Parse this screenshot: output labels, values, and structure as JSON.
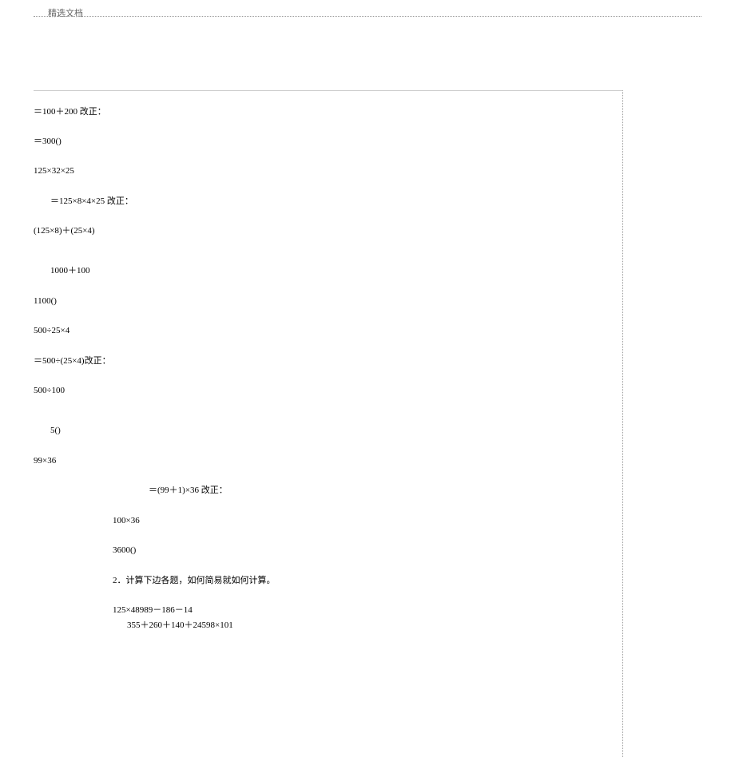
{
  "header": {
    "title": "精选文档"
  },
  "content": {
    "l1": "＝100＋200 改正：",
    "l2": "＝300()",
    "l3": "125×32×25",
    "l4": "＝125×8×4×25 改正：",
    "l5": "(125×8)＋(25×4)",
    "l6": "1000＋100",
    "l7": "1100()",
    "l8": "500÷25×4",
    "l9": "＝500÷(25×4)改正：",
    "l10": "500÷100",
    "l11": "5()",
    "l12": "99×36",
    "l13": "＝(99＋1)×36 改正：",
    "l14": "100×36",
    "l15": "3600()",
    "l16": "2．计算下边各题，如何简易就如何计算。",
    "l17": "125×48989－186－14",
    "l18": "355＋260＋140＋24598×101"
  }
}
